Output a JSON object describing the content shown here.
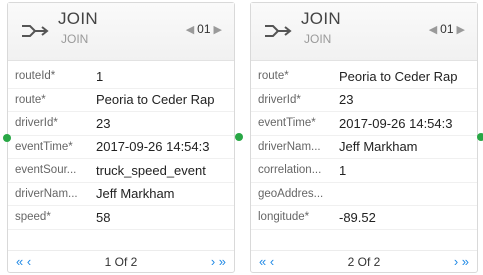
{
  "cards": [
    {
      "title": "JOIN",
      "subtitle": "JOIN",
      "step": "01",
      "rows": [
        {
          "label": "routeId*",
          "value": "1"
        },
        {
          "label": "route*",
          "value": "Peoria to Ceder Rap"
        },
        {
          "label": "driverId*",
          "value": "23"
        },
        {
          "label": "eventTime*",
          "value": "2017-09-26 14:54:3"
        },
        {
          "label": "eventSour...",
          "value": "truck_speed_event"
        },
        {
          "label": "driverNam...",
          "value": "Jeff Markham"
        },
        {
          "label": "speed*",
          "value": "58"
        }
      ],
      "pager": {
        "prev": "« ‹",
        "count": "1 Of 2",
        "next": "› »"
      }
    },
    {
      "title": "JOIN",
      "subtitle": "JOIN",
      "step": "01",
      "rows": [
        {
          "label": "route*",
          "value": "Peoria to Ceder Rap"
        },
        {
          "label": "driverId*",
          "value": "23"
        },
        {
          "label": "eventTime*",
          "value": "2017-09-26 14:54:3"
        },
        {
          "label": "driverNam...",
          "value": "Jeff Markham"
        },
        {
          "label": "correlation...",
          "value": "1"
        },
        {
          "label": "geoAddres...",
          "value": ""
        },
        {
          "label": "longitude*",
          "value": "-89.52"
        }
      ],
      "pager": {
        "prev": "« ‹",
        "count": "2 Of 2",
        "next": "› »"
      }
    }
  ],
  "colors": {
    "port": "#28a745",
    "pager_nav": "#1e88e5"
  },
  "icons": {
    "header": "join-arrow-icon",
    "step_prev": "caret-left-icon",
    "step_next": "caret-right-icon"
  }
}
